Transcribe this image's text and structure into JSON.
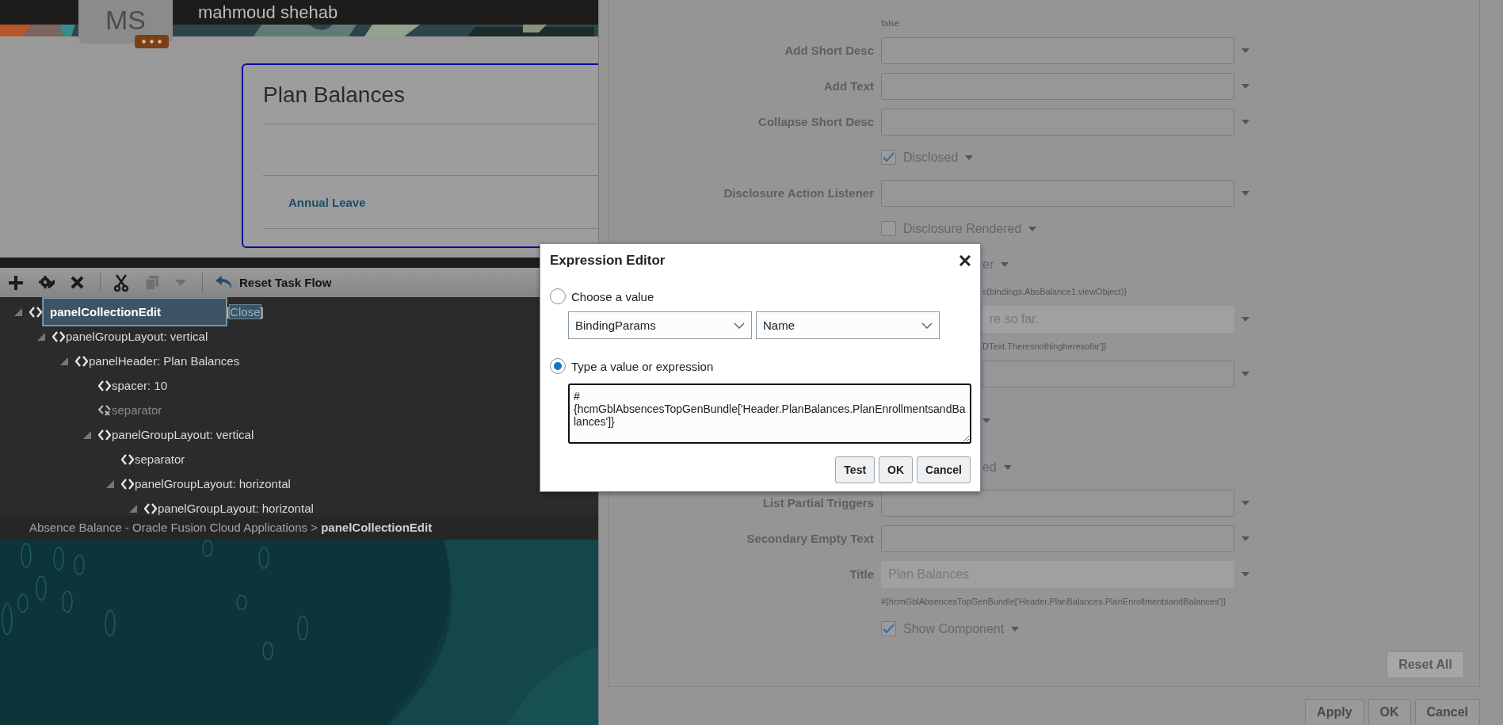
{
  "header": {
    "user_name": "mahmoud shehab",
    "initials": "MS"
  },
  "card": {
    "title": "Plan Balances",
    "link": "Annual Leave"
  },
  "toolbar": {
    "buttons": [
      {
        "kind": "add",
        "disabled": false
      },
      {
        "kind": "edit",
        "disabled": false
      },
      {
        "kind": "delete",
        "disabled": false
      },
      {
        "kind": "cut",
        "disabled": false
      },
      {
        "kind": "copy",
        "disabled": true
      },
      {
        "kind": "menu",
        "disabled": true
      },
      {
        "kind": "reset",
        "label": "Reset Task Flow",
        "disabled": false
      }
    ]
  },
  "tree": [
    {
      "label": "panelCollectionEdit",
      "selected": true,
      "disabled": false,
      "expanded": true,
      "action_open": "[",
      "action": "Close",
      "action_close": "]",
      "children": [
        {
          "label": "panelGroupLayout: vertical",
          "selected": false,
          "disabled": false,
          "expanded": true,
          "children": [
            {
              "label": "panelHeader: Plan Balances",
              "selected": false,
              "disabled": false,
              "expanded": true,
              "children": [
                {
                  "label": "spacer: 10",
                  "selected": false,
                  "disabled": false
                },
                {
                  "label": "separator",
                  "selected": false,
                  "disabled": true
                },
                {
                  "label": "panelGroupLayout: vertical",
                  "selected": false,
                  "disabled": false,
                  "expanded": true,
                  "children": [
                    {
                      "label": "separator",
                      "selected": false,
                      "disabled": false
                    },
                    {
                      "label": "panelGroupLayout: horizontal",
                      "selected": false,
                      "disabled": false,
                      "expanded": true,
                      "children": [
                        {
                          "label": "panelGroupLayout: horizontal",
                          "selected": false,
                          "disabled": false,
                          "expanded": true
                        }
                      ]
                    }
                  ]
                }
              ]
            }
          ]
        }
      ]
    }
  ],
  "breadcrumb": "Absence Balance - Oracle Fusion Cloud Applications > **panelCollectionEdit**",
  "properties": {
    "rows": [
      {
        "kind": "note",
        "text": "false",
        "covered": false
      },
      {
        "kind": "field",
        "label": "Add Short Desc",
        "disabled": false,
        "covered": false
      },
      {
        "kind": "field",
        "label": "Add Text",
        "disabled": false,
        "covered": false
      },
      {
        "kind": "field",
        "label": "Collapse Short Desc",
        "disabled": false,
        "covered": false
      },
      {
        "kind": "checkbox",
        "label": "Disclosed",
        "checked": true
      },
      {
        "kind": "field",
        "label": "Disclosure Action Listener",
        "disabled": false,
        "covered": false
      },
      {
        "kind": "checkbox",
        "label": "Disclosure Rendered",
        "checked": false
      },
      {
        "kind": "checkbox",
        "label": "er",
        "covered": true
      },
      {
        "kind": "note",
        "text": "s(bindings.AbsBalance1.viewObject)}",
        "covered": true
      },
      {
        "kind": "field",
        "value": "re so far.",
        "disabled": true,
        "covered": true
      },
      {
        "kind": "note",
        "text": "DText.Theresnothingheresofar']}",
        "covered": true
      },
      {
        "kind": "field",
        "disabled": false,
        "covered": true
      },
      {
        "kind": "checkbox",
        "covered": true
      },
      {
        "kind": "checkbox",
        "label": "ed",
        "covered": true
      },
      {
        "kind": "field",
        "label": "List Partial Triggers",
        "disabled": false,
        "covered": false
      },
      {
        "kind": "field",
        "label": "Secondary Empty Text",
        "disabled": false,
        "covered": false
      },
      {
        "kind": "field",
        "label": "Title",
        "value": "Plan Balances",
        "disabled": true,
        "covered": false
      },
      {
        "kind": "note",
        "text": "#{hcmGblAbsencesTopGenBundle['Header.PlanBalances.PlanEnrollmentsandBalances']}",
        "covered": false
      },
      {
        "kind": "checkbox",
        "label": "Show Component",
        "checked": true
      }
    ],
    "reset_button": {
      "label": "Reset All",
      "disabled": true
    }
  },
  "footer_buttons": [
    "Apply",
    "OK",
    "Cancel"
  ],
  "dialog": {
    "title": "Expression Editor",
    "options": [
      {
        "label": "Choose a value",
        "selected": false,
        "selects": [
          "BindingParams",
          "Name"
        ]
      },
      {
        "label": "Type a value or expression",
        "selected": true,
        "value": "#{hcmGblAbsencesTopGenBundle['Header.PlanBalances.PlanEnrollmentsandBalances']}"
      }
    ],
    "buttons": [
      "Test",
      "OK",
      "Cancel"
    ]
  }
}
